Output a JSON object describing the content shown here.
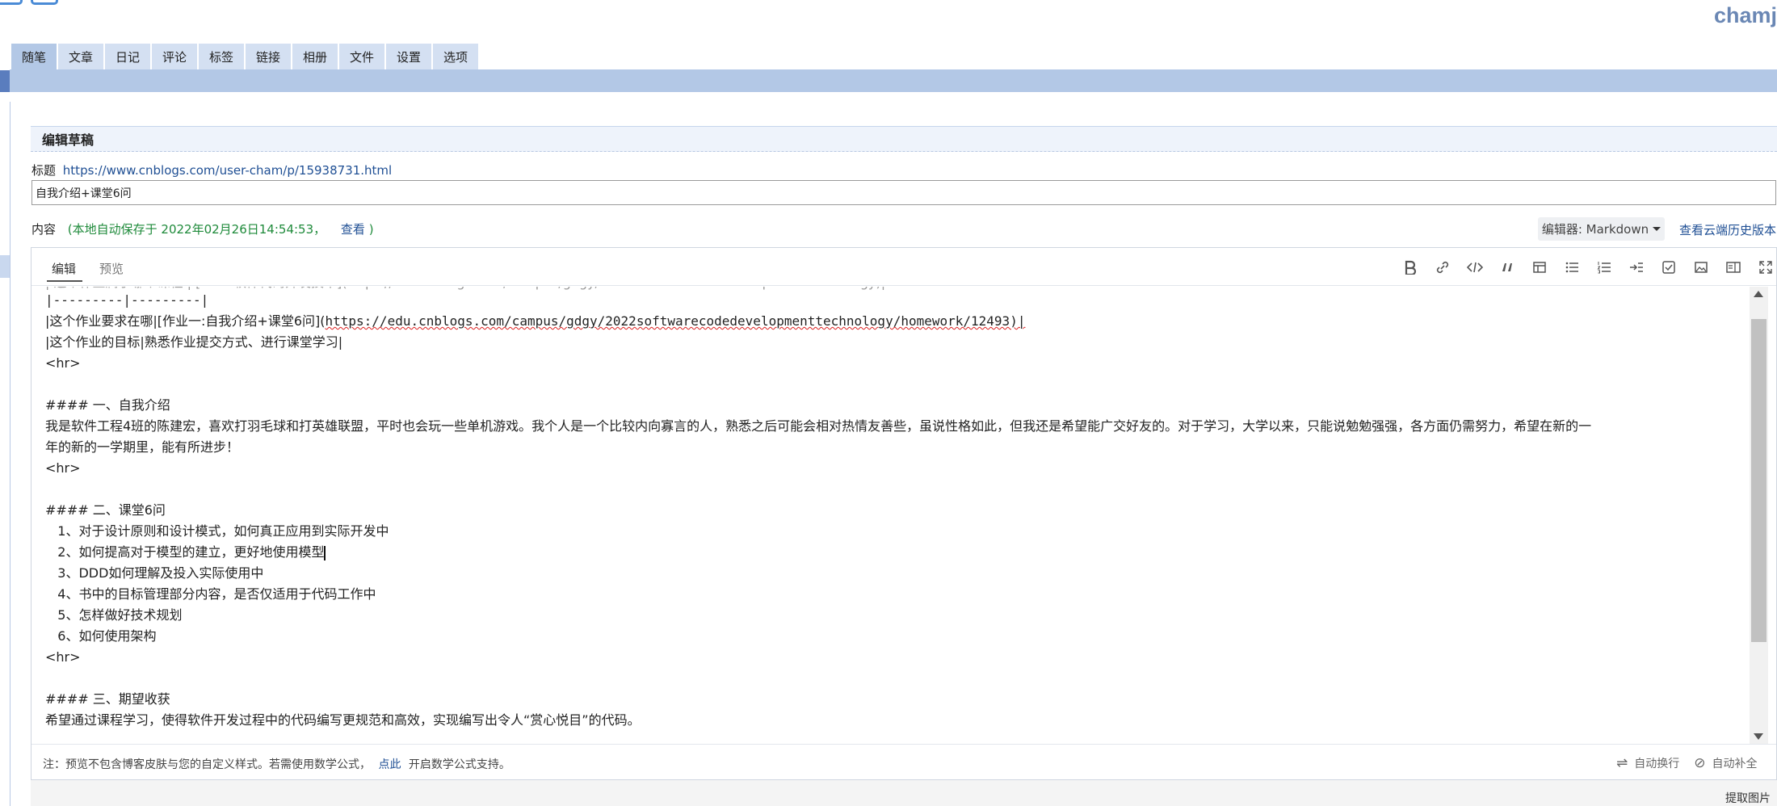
{
  "header": {
    "username": "chamj"
  },
  "tabs": [
    {
      "label": "随笔"
    },
    {
      "label": "文章"
    },
    {
      "label": "日记"
    },
    {
      "label": "评论"
    },
    {
      "label": "标签"
    },
    {
      "label": "链接"
    },
    {
      "label": "相册"
    },
    {
      "label": "文件"
    },
    {
      "label": "设置"
    },
    {
      "label": "选项"
    }
  ],
  "section": {
    "title": "编辑草稿"
  },
  "title_field": {
    "label": "标题",
    "url": "https://www.cnblogs.com/user-cham/p/15938731.html",
    "value": "自我介绍+课堂6问"
  },
  "content_field": {
    "label": "内容",
    "autosave_prefix": "(本地自动保存于 2022年02月26日14:54:53，",
    "view_link": "查看",
    "autosave_suffix": ")",
    "editor_select": "编辑器: Markdown",
    "history_link": "查看云端历史版本"
  },
  "editor": {
    "tab_edit": "编辑",
    "tab_preview": "预览",
    "toolbar_icons": [
      "bold-icon",
      "link-icon",
      "code-icon",
      "quote-icon",
      "table-icon",
      "bullet-list-icon",
      "numbered-list-icon",
      "indent-icon",
      "checkbox-icon",
      "image-icon",
      "split-view-icon",
      "fullscreen-icon"
    ],
    "lines": {
      "l1": "|---------|---------|",
      "l2a": "|这个作业要求在哪|[作业一:自我介绍+课堂6问](",
      "l2b": "https://edu.cnblogs.com/campus/gdgy/2022softwarecodedevelopmenttechnology/homework/12493)|",
      "l3": "|这个作业的目标|熟悉作业提交方式、进行课堂学习|",
      "l4": "<hr>",
      "l5": "#### 一、自我介绍",
      "l6": "我是软件工程4班的陈建宏，喜欢打羽毛球和打英雄联盟，平时也会玩一些单机游戏。我个人是一个比较内向寡言的人，熟悉之后可能会相对热情友善些，虽说性格如此，但我还是希望能广交好友的。对于学习，大学以来，只能说勉勉强强，各方面仍需努力，希望在新的一",
      "l7": "年的新的一学期里，能有所进步！",
      "l8": "<hr>",
      "l9": "#### 二、课堂6问",
      "l10": "   1、对于设计原则和设计模式，如何真正应用到实际开发中",
      "l11": "   2、如何提高对于模型的建立，更好地使用模型",
      "l12": "   3、DDD如何理解及投入实际使用中",
      "l13": "   4、书中的目标管理部分内容，是否仅适用于代码工作中",
      "l14": "   5、怎样做好技术规划",
      "l15": "   6、如何使用架构",
      "l16": "<hr>",
      "l17": "#### 三、期望收获",
      "l18": "希望通过课程学习，使得软件开发过程中的代码编写更规范和高效，实现编写出令人“赏心悦目”的代码。"
    },
    "footer_note_prefix": "注：预览不包含博客皮肤与您的自定义样式。若需使用数学公式，",
    "footer_note_link": "点此",
    "footer_note_suffix": "开启数学公式支持。",
    "auto_wrap": "自动换行",
    "auto_complete": "自动补全"
  },
  "bottom": {
    "extract_images": "提取图片"
  }
}
